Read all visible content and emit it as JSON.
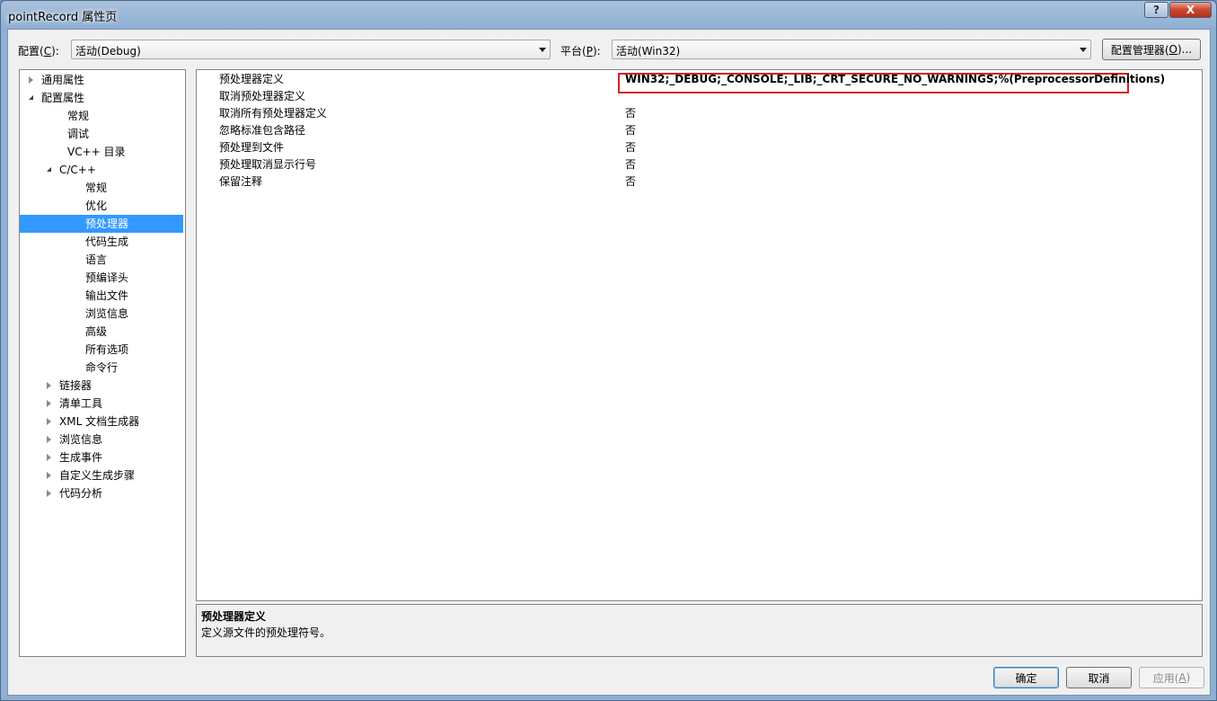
{
  "window": {
    "title": "pointRecord 属性页",
    "help": "?",
    "close": "X"
  },
  "toolbar": {
    "config_label": "配置(",
    "config_key": "C",
    "config_suffix": "):",
    "config_value": "活动(Debug)",
    "platform_label": "平台(",
    "platform_key": "P",
    "platform_suffix": "):",
    "platform_value": "活动(Win32)",
    "config_manager_label": "配置管理器(",
    "config_manager_key": "O",
    "config_manager_suffix": ")..."
  },
  "tree": [
    {
      "label": "通用属性",
      "level": 0,
      "state": "closed"
    },
    {
      "label": "配置属性",
      "level": 0,
      "state": "open"
    },
    {
      "label": "常规",
      "level": 1,
      "state": "leaf"
    },
    {
      "label": "调试",
      "level": 1,
      "state": "leaf"
    },
    {
      "label": "VC++ 目录",
      "level": 1,
      "state": "leaf"
    },
    {
      "label": "C/C++",
      "level": 1,
      "state": "open"
    },
    {
      "label": "常规",
      "level": 2,
      "state": "leaf"
    },
    {
      "label": "优化",
      "level": 2,
      "state": "leaf"
    },
    {
      "label": "预处理器",
      "level": 2,
      "state": "leaf",
      "selected": true
    },
    {
      "label": "代码生成",
      "level": 2,
      "state": "leaf"
    },
    {
      "label": "语言",
      "level": 2,
      "state": "leaf"
    },
    {
      "label": "预编译头",
      "level": 2,
      "state": "leaf"
    },
    {
      "label": "输出文件",
      "level": 2,
      "state": "leaf"
    },
    {
      "label": "浏览信息",
      "level": 2,
      "state": "leaf"
    },
    {
      "label": "高级",
      "level": 2,
      "state": "leaf"
    },
    {
      "label": "所有选项",
      "level": 2,
      "state": "leaf"
    },
    {
      "label": "命令行",
      "level": 2,
      "state": "leaf"
    },
    {
      "label": "链接器",
      "level": 1,
      "state": "closed"
    },
    {
      "label": "清单工具",
      "level": 1,
      "state": "closed"
    },
    {
      "label": "XML 文档生成器",
      "level": 1,
      "state": "closed"
    },
    {
      "label": "浏览信息",
      "level": 1,
      "state": "closed"
    },
    {
      "label": "生成事件",
      "level": 1,
      "state": "closed"
    },
    {
      "label": "自定义生成步骤",
      "level": 1,
      "state": "closed"
    },
    {
      "label": "代码分析",
      "level": 1,
      "state": "closed"
    }
  ],
  "properties": [
    {
      "name": "预处理器定义",
      "value": "WIN32;_DEBUG;_CONSOLE;_LIB;_CRT_SECURE_NO_WARNINGS;%(PreprocessorDefinitions)",
      "bold": true
    },
    {
      "name": "取消预处理器定义",
      "value": ""
    },
    {
      "name": "取消所有预处理器定义",
      "value": "否"
    },
    {
      "name": "忽略标准包含路径",
      "value": "否"
    },
    {
      "name": "预处理到文件",
      "value": "否"
    },
    {
      "name": "预处理取消显示行号",
      "value": "否"
    },
    {
      "name": "保留注释",
      "value": "否"
    }
  ],
  "description": {
    "title": "预处理器定义",
    "text": "定义源文件的预处理符号。"
  },
  "buttons": {
    "ok": "确定",
    "cancel": "取消",
    "apply_label": "应用(",
    "apply_key": "A",
    "apply_suffix": ")"
  },
  "colors": {
    "selection": "#3399ff",
    "highlight_box": "#d82020"
  }
}
